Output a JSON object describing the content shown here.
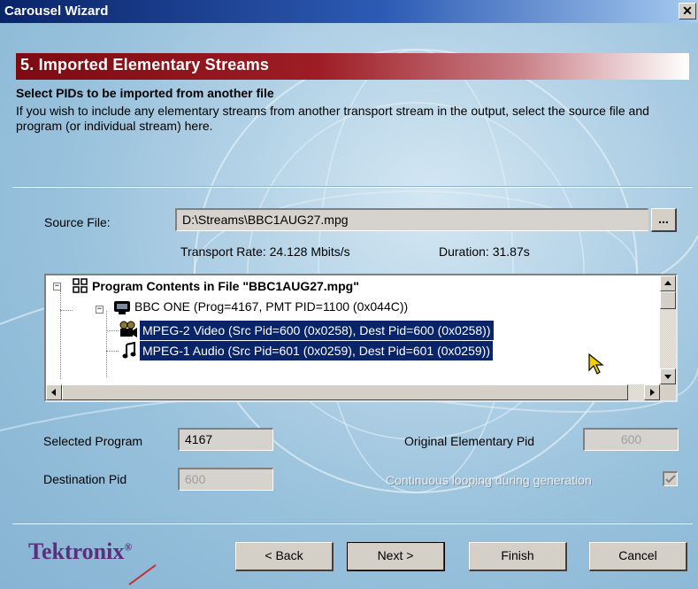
{
  "window": {
    "title": "Carousel Wizard",
    "close_label": "✕"
  },
  "step": {
    "title": "5. Imported Elementary Streams",
    "subtitle": "Select PIDs to be imported from another file",
    "description": "If you wish to include any elementary streams from another transport stream in the output, select the source file and program (or individual stream) here."
  },
  "source": {
    "label": "Source File:",
    "value": "D:\\Streams\\BBC1AUG27.mpg",
    "browse_label": "...",
    "transport_rate": "Transport Rate:  24.128 Mbits/s",
    "duration": "Duration:  31.87s"
  },
  "tree": {
    "root": {
      "label": "Program Contents in File \"BBC1AUG27.mpg\"",
      "icon": "program-grid-icon"
    },
    "program": {
      "label": "BBC ONE (Prog=4167, PMT PID=1100 (0x044C))",
      "icon": "tv-icon"
    },
    "streams": [
      {
        "label": "MPEG-2 Video (Src Pid=600 (0x0258), Dest Pid=600 (0x0258))",
        "icon": "video-camera-icon",
        "selected": true
      },
      {
        "label": "MPEG-1 Audio (Src Pid=601 (0x0259), Dest Pid=601 (0x0259))",
        "icon": "music-note-icon",
        "selected": true
      }
    ]
  },
  "fields": {
    "selected_program": {
      "label": "Selected Program",
      "value": "4167"
    },
    "original_pid": {
      "label": "Original Elementary Pid",
      "value": "600"
    },
    "destination_pid": {
      "label": "Destination Pid",
      "value": "600"
    },
    "looping": {
      "label": "Continuous looping during generation",
      "checked": true
    }
  },
  "footer": {
    "logo": "Tektronix",
    "logo_mark": "®",
    "back": "< Back",
    "next": "Next >",
    "finish": "Finish",
    "cancel": "Cancel"
  },
  "colors": {
    "accent_banner": "#9e1d25",
    "selection": "#0a246a",
    "titlebar": "#0a246a",
    "logo": "#5b2f7c"
  }
}
